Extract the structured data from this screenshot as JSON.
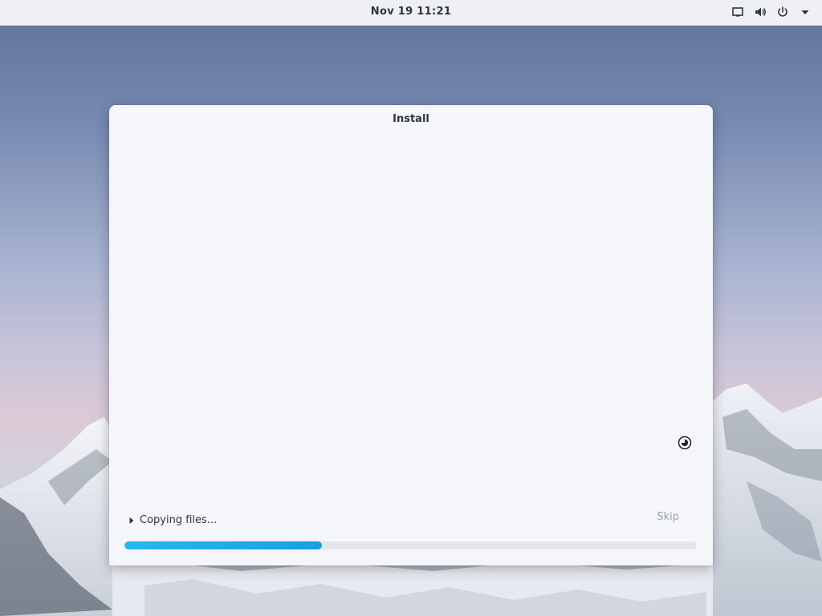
{
  "topbar": {
    "clock": "Nov 19  11:21",
    "tray_icons": [
      "screen-icon",
      "volume-icon",
      "power-icon",
      "menu-arrow-icon"
    ]
  },
  "window": {
    "title": "Install",
    "status_text": "Copying files...",
    "skip_label": "Skip",
    "progress": 0.345
  },
  "colors": {
    "accent": "#1b9ee4",
    "window_bg": "#f4f6fa",
    "topbar_bg": "#eef0f4"
  }
}
